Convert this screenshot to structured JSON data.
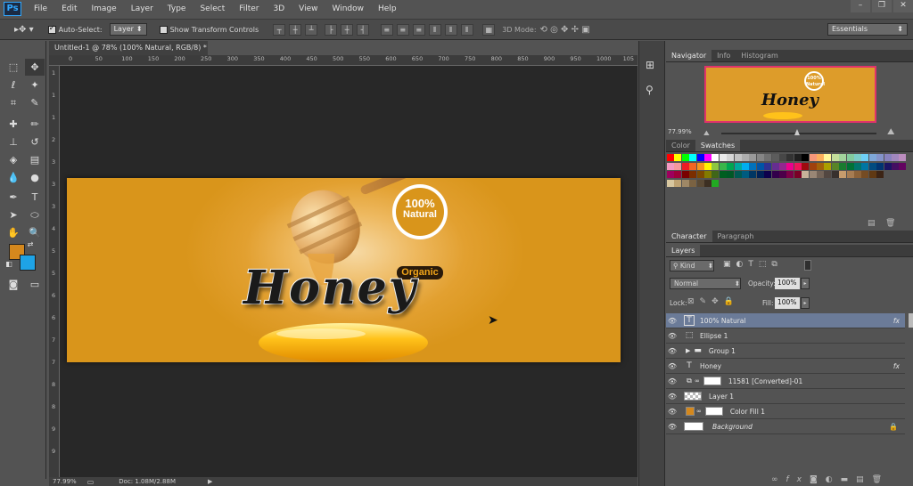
{
  "app": {
    "logo": "Ps"
  },
  "menu": [
    "File",
    "Edit",
    "Image",
    "Layer",
    "Type",
    "Select",
    "Filter",
    "3D",
    "View",
    "Window",
    "Help"
  ],
  "options": {
    "auto_select_label": "Auto-Select:",
    "auto_select_value": "Layer",
    "transform_label": "Show Transform Controls",
    "mode_3d": "3D Mode:",
    "workspace": "Essentials"
  },
  "document": {
    "tab_title": "Untitled-1 @ 78% (100% Natural, RGB/8) *",
    "close": "×",
    "zoom": "77.99%",
    "doc_info": "Doc: 1.08M/2.88M"
  },
  "ruler": {
    "top_ticks": [
      "0",
      "50",
      "100",
      "150",
      "200",
      "250",
      "300",
      "350",
      "400",
      "450",
      "500",
      "550",
      "600",
      "650",
      "700",
      "750",
      "800",
      "850",
      "900",
      "950",
      "1000",
      "105"
    ],
    "left_ticks": [
      "1",
      "1",
      "1",
      "2",
      "3",
      "3",
      "3",
      "4",
      "5",
      "5",
      "6",
      "6",
      "7",
      "7",
      "8",
      "8",
      "9",
      "9"
    ]
  },
  "artwork": {
    "badge_line1": "100%",
    "badge_line2": "Natural",
    "organic": "Organic",
    "honey": "Honey"
  },
  "navigator": {
    "tabs": [
      "Navigator",
      "Info",
      "Histogram"
    ],
    "zoom": "77.99%",
    "thumb_badge1": "100%",
    "thumb_badge2": "Natural",
    "thumb_honey": "Honey"
  },
  "swatches": {
    "tabs": [
      "Color",
      "Swatches"
    ]
  },
  "character": {
    "tabs": [
      "Character",
      "Paragraph"
    ]
  },
  "layers": {
    "tab": "Layers",
    "kind": "Kind",
    "blend": "Normal",
    "opacity_label": "Opacity:",
    "opacity": "100%",
    "lock_label": "Lock:",
    "fill_label": "Fill:",
    "fill": "100%",
    "rows": [
      {
        "name": "100% Natural",
        "type": "T",
        "fx": "fx",
        "selected": true
      },
      {
        "name": "Ellipse 1",
        "type": "shape",
        "fx": "",
        "selected": false
      },
      {
        "name": "Group 1",
        "type": "group",
        "fx": "",
        "selected": false
      },
      {
        "name": "Honey",
        "type": "T",
        "fx": "fx",
        "selected": false
      },
      {
        "name": "11581 [Converted]-01",
        "type": "smart",
        "fx": "",
        "selected": false
      },
      {
        "name": "Layer 1",
        "type": "pixel",
        "fx": "",
        "selected": false
      },
      {
        "name": "Color Fill 1",
        "type": "fill",
        "fx": "",
        "selected": false
      },
      {
        "name": "Background",
        "type": "bg",
        "fx": "",
        "selected": false
      }
    ]
  },
  "colors": {
    "foreground": "#d4881d",
    "background": "#1ea3e6",
    "selected_layer": "#6b7b98",
    "art_bg": "#e2a030"
  }
}
